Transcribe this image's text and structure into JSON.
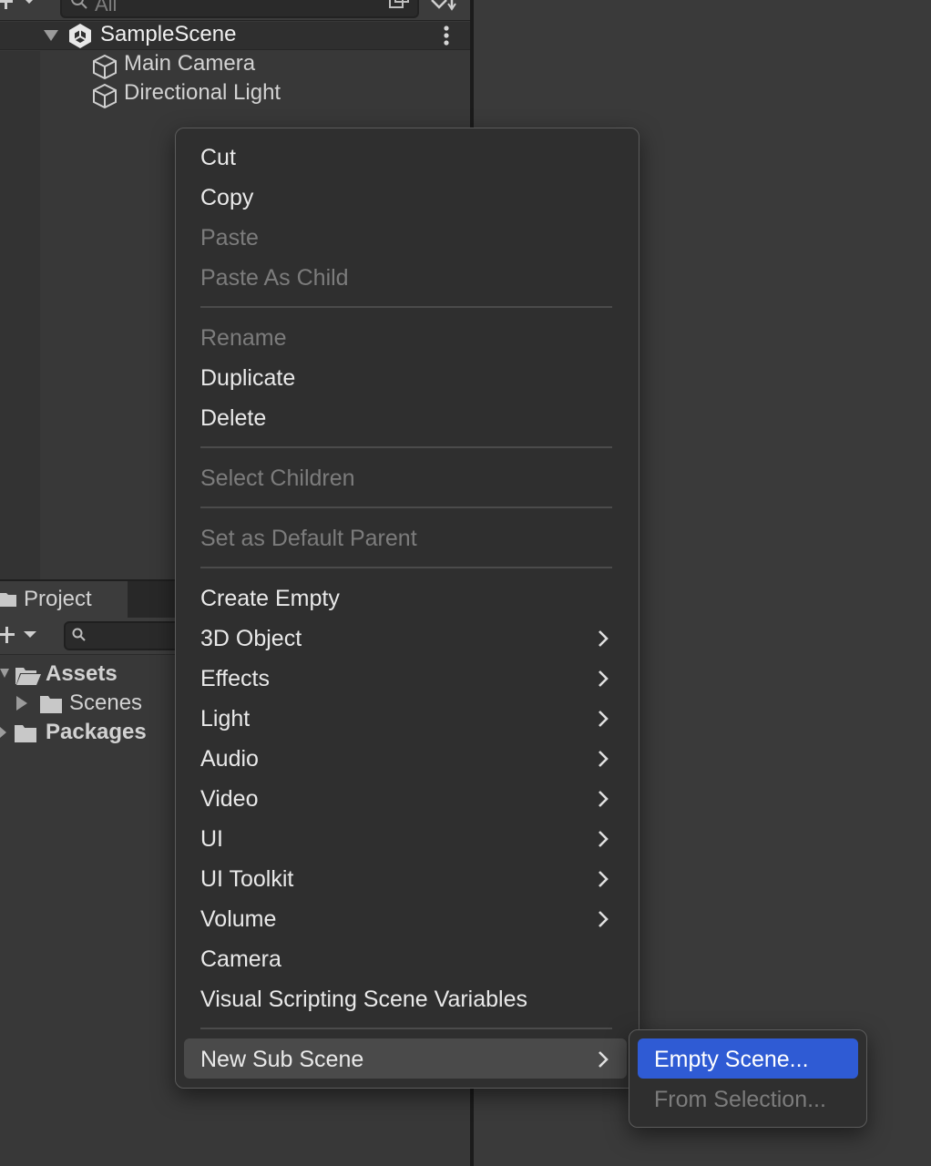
{
  "hierarchy": {
    "search_placeholder": "All",
    "scene_name": "SampleScene",
    "objects": [
      "Main Camera",
      "Directional Light"
    ]
  },
  "project": {
    "tab_label": "Project",
    "tree": {
      "assets": "Assets",
      "scenes": "Scenes",
      "packages": "Packages"
    }
  },
  "context_menu": {
    "cut": "Cut",
    "copy": "Copy",
    "paste": "Paste",
    "paste_as_child": "Paste As Child",
    "rename": "Rename",
    "duplicate": "Duplicate",
    "delete": "Delete",
    "select_children": "Select Children",
    "set_default_parent": "Set as Default Parent",
    "create_empty": "Create Empty",
    "object_3d": "3D Object",
    "effects": "Effects",
    "light": "Light",
    "audio": "Audio",
    "video": "Video",
    "ui": "UI",
    "ui_toolkit": "UI Toolkit",
    "volume": "Volume",
    "camera": "Camera",
    "visual_scripting": "Visual Scripting Scene Variables",
    "new_sub_scene": "New Sub Scene"
  },
  "submenu": {
    "empty_scene": "Empty Scene...",
    "from_selection": "From Selection..."
  },
  "colors": {
    "menu_bg": "#2f2f2f",
    "highlight_blue": "#2f5bd4",
    "hover_gray": "#4a4a4a",
    "disabled_text": "#7c7c7c"
  }
}
